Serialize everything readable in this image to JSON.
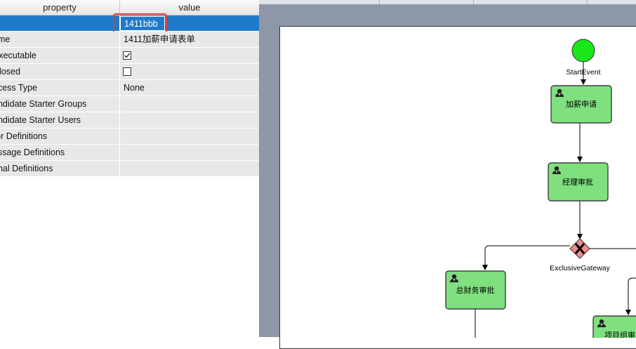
{
  "property_panel": {
    "headers": {
      "property": "property",
      "value": "value"
    },
    "rows": [
      {
        "name": "",
        "value": "1411bbb"
      },
      {
        "name": "ame",
        "value": "1411加薪申请表单"
      },
      {
        "name": "Executable",
        "checked": true
      },
      {
        "name": "Closed",
        "checked": false
      },
      {
        "name": "ocess Type",
        "value": "None"
      },
      {
        "name": "andidate Starter Groups",
        "value": ""
      },
      {
        "name": "andidate Starter Users",
        "value": ""
      },
      {
        "name": "ror Definitions",
        "value": ""
      },
      {
        "name": "essage Definitions",
        "value": ""
      },
      {
        "name": "gnal Definitions",
        "value": ""
      }
    ]
  },
  "diagram": {
    "start_event": "StartEvent",
    "tasks": {
      "apply": "加薪申请",
      "manager": "经理审批",
      "finance": "总财务审批",
      "project": "项目组审"
    },
    "gateway": "ExclusiveGateway"
  },
  "colors": {
    "selection": "#1f7bc9",
    "highlight": "#e23b3b",
    "task_fill": "#7ee07e",
    "start_fill": "#19e619",
    "gateway_fill": "#f08a8a",
    "canvas_bg": "#8e97a8"
  },
  "icons": [
    "user-icon",
    "x-gateway-icon",
    "check-icon"
  ]
}
